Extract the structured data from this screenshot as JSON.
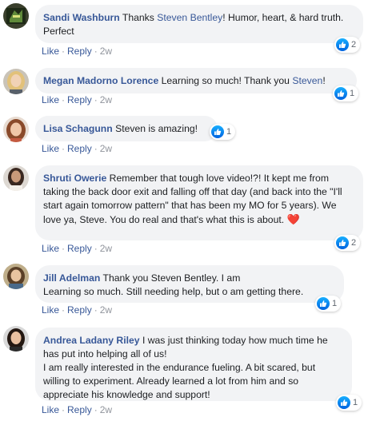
{
  "comments": [
    {
      "author": "Sandi Washburn",
      "parts": [
        " Thanks ",
        "Steven Bentley",
        "! Humor, heart, & hard truth. Perfect"
      ],
      "reaction_count": "2",
      "like_label": "Like",
      "reply_label": "Reply",
      "time": "2w"
    },
    {
      "author": "Megan Madorno Lorence",
      "parts": [
        " Learning so much! Thank you ",
        "Steven",
        "!"
      ],
      "reaction_count": "1",
      "like_label": "Like",
      "reply_label": "Reply",
      "time": "2w"
    },
    {
      "author": "Lisa Schagunn",
      "text": " Steven is amazing!",
      "reaction_count": "1",
      "like_label": "Like",
      "reply_label": "Reply",
      "time": "2w"
    },
    {
      "author": "Shruti Owerie",
      "text": " Remember that tough love video!?! It kept me from taking the back door exit and falling off that day (and back into the \"I'll start again tomorrow pattern\" that has been my MO for 5 years). We love ya, Steve. You do real and that's what this is about. ",
      "emoji": "❤️",
      "reaction_count": "2",
      "like_label": "Like",
      "reply_label": "Reply",
      "time": "2w"
    },
    {
      "author": "Jill Adelman",
      "text": " Thank you Steven Bentley. I am",
      "text2": "Learning so much. Still needing help, but o am getting there.",
      "reaction_count": "1",
      "like_label": "Like",
      "reply_label": "Reply",
      "time": "2w"
    },
    {
      "author": "Andrea Ladany Riley",
      "text": " I was just thinking today how much time he has put into helping all of us!",
      "text2": "I am really interested in the endurance fueling. A bit scared, but willing to experiment. Already learned a lot from him and so appreciate his knowledge and support!",
      "reaction_count": "1",
      "like_label": "Like",
      "reply_label": "Reply",
      "time": "2w"
    }
  ],
  "colors": {
    "link": "#385898",
    "bubble": "#f2f3f5",
    "like_blue": "#1877f2",
    "muted": "#90949c"
  },
  "separator": "·",
  "icons": {
    "reaction": "like-thumb-icon"
  }
}
